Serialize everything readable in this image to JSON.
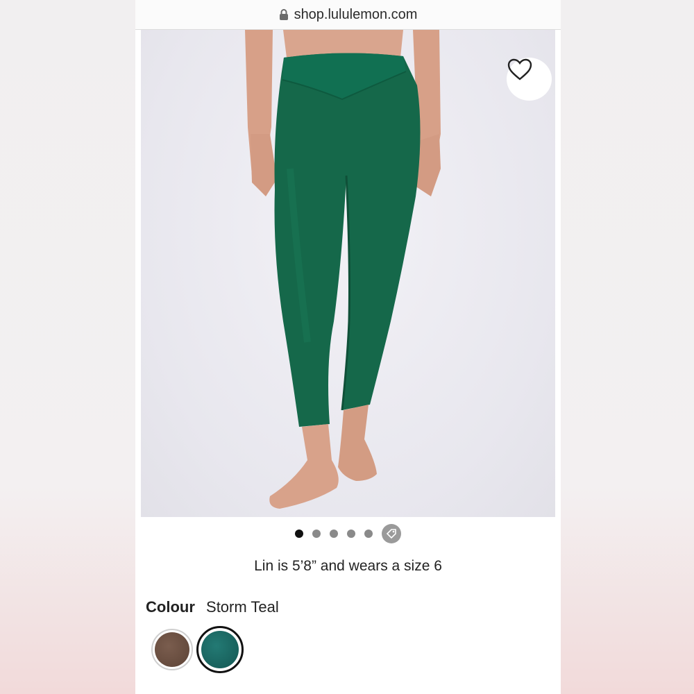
{
  "browser": {
    "url": "shop.lululemon.com"
  },
  "product": {
    "image_alt": "Storm Teal leggings on model",
    "favorite_icon": "heart-icon",
    "carousel": {
      "total": 5,
      "active": 1,
      "extra": "tag-icon"
    },
    "model_note": "Lin is 5’8” and wears a size 6",
    "colour_label": "Colour",
    "colour_value": "Storm Teal",
    "swatches": [
      {
        "name": "brown",
        "color": "#6e5244",
        "selected": false
      },
      {
        "name": "Storm Teal",
        "color": "#1b6b66",
        "selected": true
      }
    ]
  },
  "colors": {
    "legging": "#15684a",
    "skin": "#d8a28a",
    "background": "#e9e8ef"
  }
}
